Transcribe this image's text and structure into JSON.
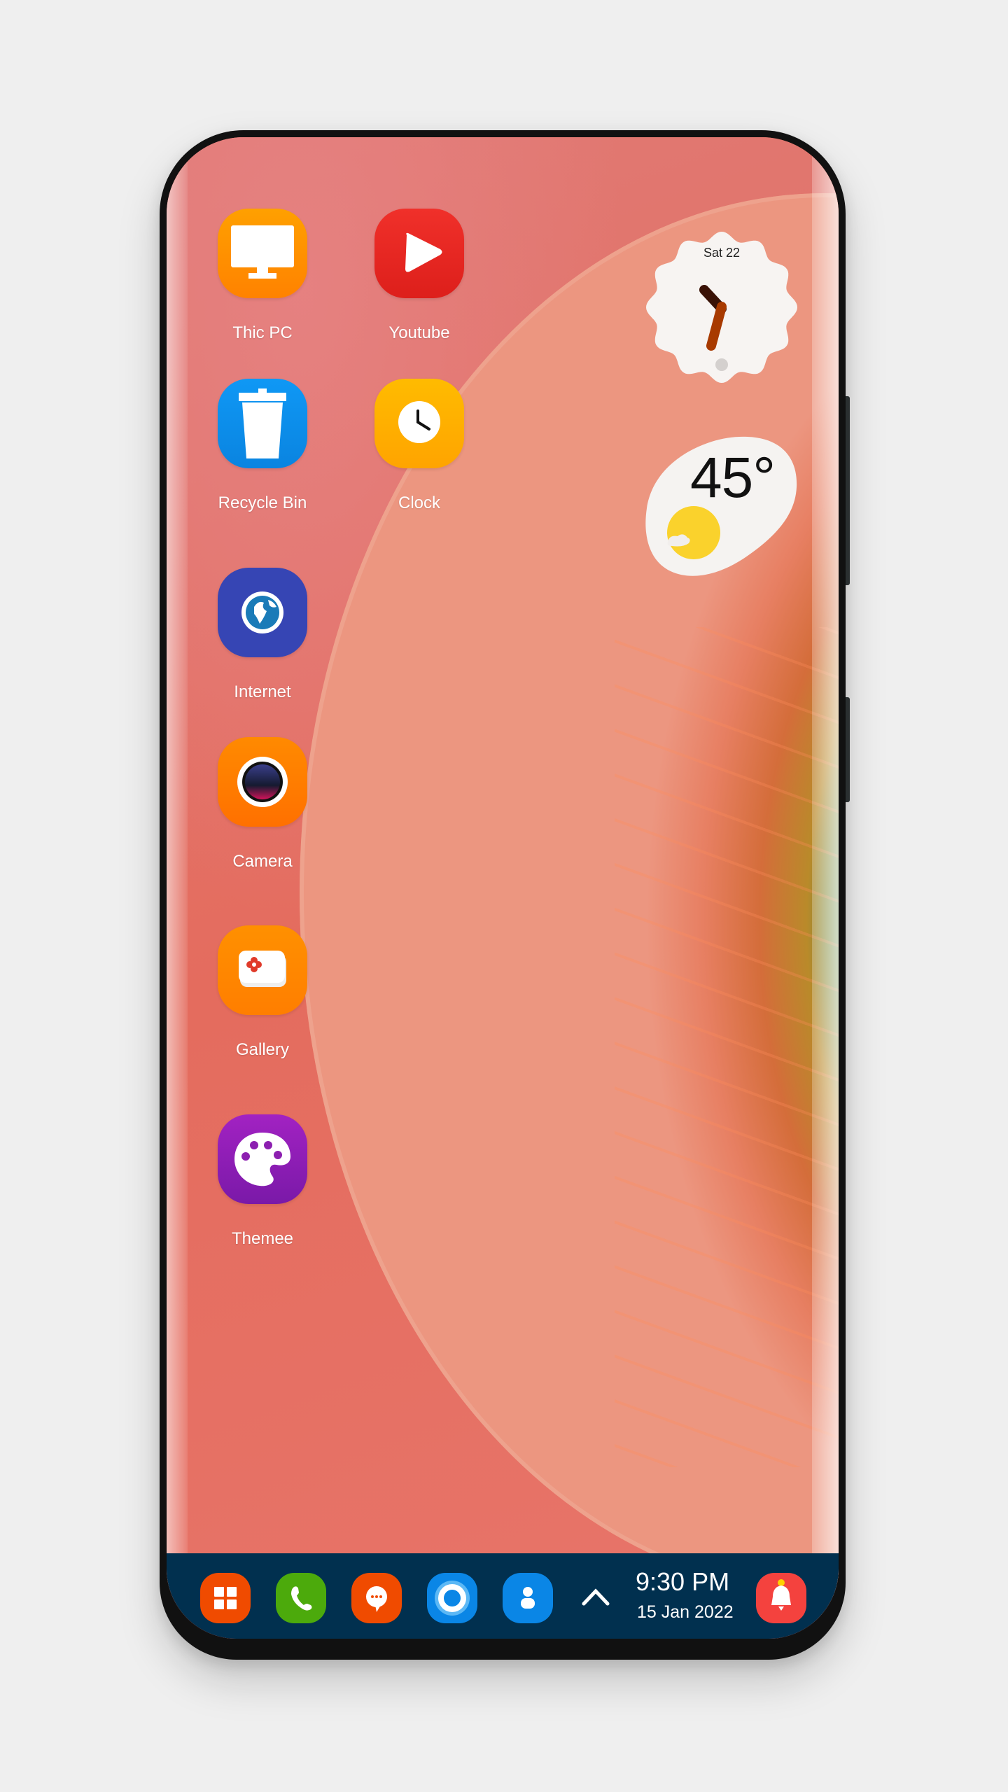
{
  "desktop": {
    "apps": [
      {
        "label": "Thic PC",
        "icon": "monitor-icon",
        "color": "#ff8c00"
      },
      {
        "label": "Youtube",
        "icon": "play-icon",
        "color": "#e8221f"
      },
      {
        "label": "Recycle Bin",
        "icon": "trash-icon",
        "color": "#0a8ff0"
      },
      {
        "label": "Clock",
        "icon": "clock-icon",
        "color": "#ffae00"
      },
      {
        "label": "Internet",
        "icon": "globe-icon",
        "color": "#3543b5"
      },
      {
        "label": "Camera",
        "icon": "camera-icon",
        "color": "#ff7a00"
      },
      {
        "label": "Gallery",
        "icon": "gallery-icon",
        "color": "#ff8500"
      },
      {
        "label": "Themee",
        "icon": "palette-icon",
        "color": "#8c1fb0"
      }
    ]
  },
  "widgets": {
    "clock": {
      "date": "Sat 22"
    },
    "weather": {
      "temperature": "45°",
      "condition_icon": "sunny-partly-cloudy-icon"
    }
  },
  "taskbar": {
    "icons": [
      {
        "name": "start-menu",
        "icon": "windows-grid-icon",
        "color": "#f04b00"
      },
      {
        "name": "phone",
        "icon": "phone-icon",
        "color": "#4caa0c"
      },
      {
        "name": "messages",
        "icon": "chat-bubble-icon",
        "color": "#f04b00"
      },
      {
        "name": "cortana",
        "icon": "circle-ring-icon",
        "color": "#0a86e6"
      },
      {
        "name": "contacts",
        "icon": "person-icon",
        "color": "#0a86e6"
      }
    ],
    "tray_toggle": "chevron-up-icon",
    "time": "9:30 PM",
    "date": "15 Jan 2022",
    "notification": {
      "icon": "bell-icon",
      "color": "#f4423e"
    }
  }
}
